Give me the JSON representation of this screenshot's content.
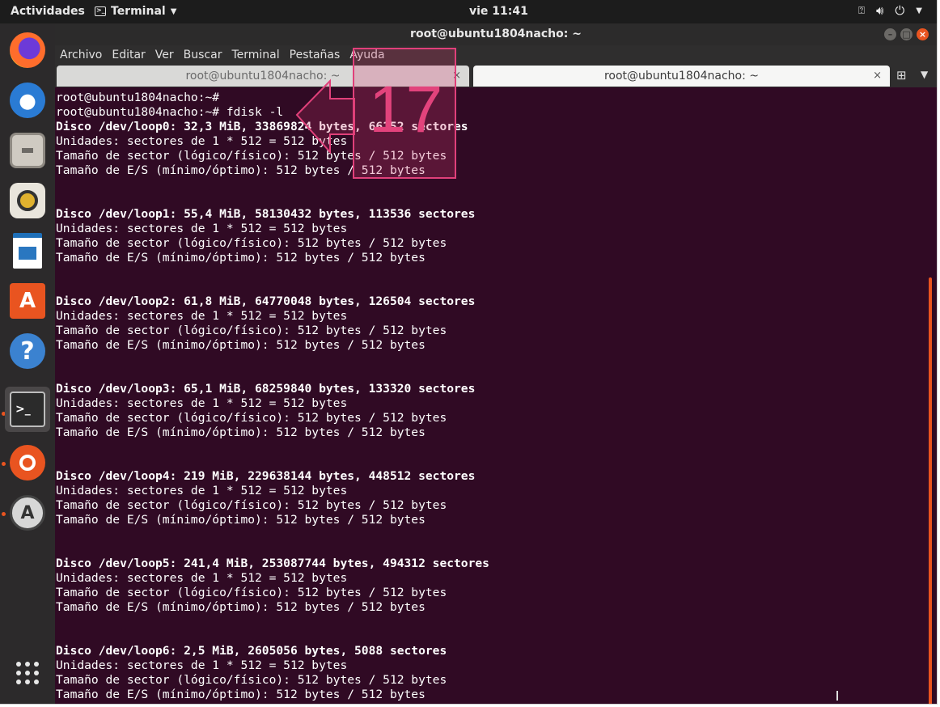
{
  "topbar": {
    "activities": "Actividades",
    "app_name": "Terminal",
    "clock": "vie 11:41"
  },
  "window": {
    "title": "root@ubuntu1804nacho: ~"
  },
  "menu": [
    "Archivo",
    "Editar",
    "Ver",
    "Buscar",
    "Terminal",
    "Pestañas",
    "Ayuda"
  ],
  "tabs": [
    {
      "label": "root@ubuntu1804nacho: ~",
      "active": false
    },
    {
      "label": "root@ubuntu1804nacho: ~",
      "active": true
    }
  ],
  "dock": {
    "items": [
      "firefox-icon",
      "thunderbird-icon",
      "files-icon",
      "rhythmbox-icon",
      "libreoffice-writer-icon",
      "software-center-icon",
      "help-icon",
      "terminal-icon",
      "ubuntu-icon",
      "software-updater-icon",
      "show-apps-icon"
    ]
  },
  "annotation": {
    "step": "17"
  },
  "terminal": {
    "lines": [
      {
        "t": "root@ubuntu1804nacho:~#",
        "b": false
      },
      {
        "t": "root@ubuntu1804nacho:~# fdisk -l",
        "b": false
      },
      {
        "t": "Disco /dev/loop0: 32,3 MiB, 33869824 bytes, 66152 sectores",
        "b": true
      },
      {
        "t": "Unidades: sectores de 1 * 512 = 512 bytes",
        "b": false
      },
      {
        "t": "Tamaño de sector (lógico/físico): 512 bytes / 512 bytes",
        "b": false
      },
      {
        "t": "Tamaño de E/S (mínimo/óptimo): 512 bytes / 512 bytes",
        "b": false
      },
      {
        "t": "",
        "b": false
      },
      {
        "t": "",
        "b": false
      },
      {
        "t": "Disco /dev/loop1: 55,4 MiB, 58130432 bytes, 113536 sectores",
        "b": true
      },
      {
        "t": "Unidades: sectores de 1 * 512 = 512 bytes",
        "b": false
      },
      {
        "t": "Tamaño de sector (lógico/físico): 512 bytes / 512 bytes",
        "b": false
      },
      {
        "t": "Tamaño de E/S (mínimo/óptimo): 512 bytes / 512 bytes",
        "b": false
      },
      {
        "t": "",
        "b": false
      },
      {
        "t": "",
        "b": false
      },
      {
        "t": "Disco /dev/loop2: 61,8 MiB, 64770048 bytes, 126504 sectores",
        "b": true
      },
      {
        "t": "Unidades: sectores de 1 * 512 = 512 bytes",
        "b": false
      },
      {
        "t": "Tamaño de sector (lógico/físico): 512 bytes / 512 bytes",
        "b": false
      },
      {
        "t": "Tamaño de E/S (mínimo/óptimo): 512 bytes / 512 bytes",
        "b": false
      },
      {
        "t": "",
        "b": false
      },
      {
        "t": "",
        "b": false
      },
      {
        "t": "Disco /dev/loop3: 65,1 MiB, 68259840 bytes, 133320 sectores",
        "b": true
      },
      {
        "t": "Unidades: sectores de 1 * 512 = 512 bytes",
        "b": false
      },
      {
        "t": "Tamaño de sector (lógico/físico): 512 bytes / 512 bytes",
        "b": false
      },
      {
        "t": "Tamaño de E/S (mínimo/óptimo): 512 bytes / 512 bytes",
        "b": false
      },
      {
        "t": "",
        "b": false
      },
      {
        "t": "",
        "b": false
      },
      {
        "t": "Disco /dev/loop4: 219 MiB, 229638144 bytes, 448512 sectores",
        "b": true
      },
      {
        "t": "Unidades: sectores de 1 * 512 = 512 bytes",
        "b": false
      },
      {
        "t": "Tamaño de sector (lógico/físico): 512 bytes / 512 bytes",
        "b": false
      },
      {
        "t": "Tamaño de E/S (mínimo/óptimo): 512 bytes / 512 bytes",
        "b": false
      },
      {
        "t": "",
        "b": false
      },
      {
        "t": "",
        "b": false
      },
      {
        "t": "Disco /dev/loop5: 241,4 MiB, 253087744 bytes, 494312 sectores",
        "b": true
      },
      {
        "t": "Unidades: sectores de 1 * 512 = 512 bytes",
        "b": false
      },
      {
        "t": "Tamaño de sector (lógico/físico): 512 bytes / 512 bytes",
        "b": false
      },
      {
        "t": "Tamaño de E/S (mínimo/óptimo): 512 bytes / 512 bytes",
        "b": false
      },
      {
        "t": "",
        "b": false
      },
      {
        "t": "",
        "b": false
      },
      {
        "t": "Disco /dev/loop6: 2,5 MiB, 2605056 bytes, 5088 sectores",
        "b": true
      },
      {
        "t": "Unidades: sectores de 1 * 512 = 512 bytes",
        "b": false
      },
      {
        "t": "Tamaño de sector (lógico/físico): 512 bytes / 512 bytes",
        "b": false
      },
      {
        "t": "Tamaño de E/S (mínimo/óptimo): 512 bytes / 512 bytes",
        "b": false
      }
    ]
  }
}
